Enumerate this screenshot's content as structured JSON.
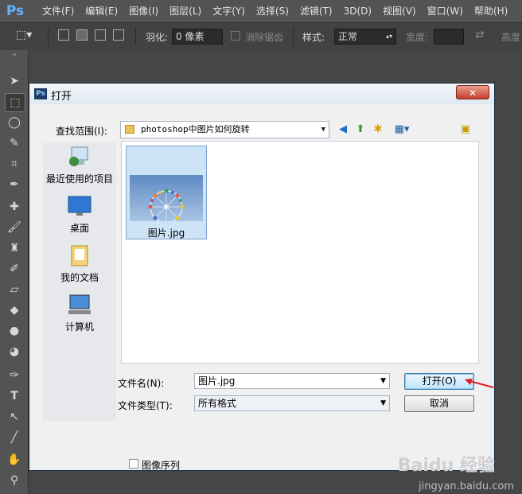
{
  "app": {
    "logo": "Ps"
  },
  "menu": [
    "文件(F)",
    "编辑(E)",
    "图像(I)",
    "图层(L)",
    "文字(Y)",
    "选择(S)",
    "滤镜(T)",
    "3D(D)",
    "视图(V)",
    "窗口(W)",
    "帮助(H)"
  ],
  "options": {
    "feather_label": "羽化:",
    "feather_value": "0 像素",
    "antialias_label": "消除锯齿",
    "style_label": "样式:",
    "style_value": "正常",
    "width_label": "宽度:",
    "height_label": "高度"
  },
  "dialog": {
    "title": "打开",
    "look_in_label": "查找范围(I):",
    "look_in_value": "photoshop中图片如何旋转",
    "places": [
      {
        "label": "最近使用的项目",
        "icon": "recent-items-icon"
      },
      {
        "label": "桌面",
        "icon": "desktop-icon"
      },
      {
        "label": "我的文档",
        "icon": "my-documents-icon"
      },
      {
        "label": "计算机",
        "icon": "computer-icon"
      }
    ],
    "files": [
      {
        "name": "图片.jpg"
      }
    ],
    "file_name_label": "文件名(N):",
    "file_name_value": "图片.jpg",
    "file_type_label": "文件类型(T):",
    "file_type_value": "所有格式",
    "open_button": "打开(O)",
    "cancel_button": "取消",
    "image_sequence_label": "图像序列"
  },
  "watermark": {
    "logo": "Baidu 经验",
    "url": "jingyan.baidu.com"
  },
  "colors": {
    "dialog_close": "#c73c2a",
    "accent_arrow": "#e02020"
  }
}
